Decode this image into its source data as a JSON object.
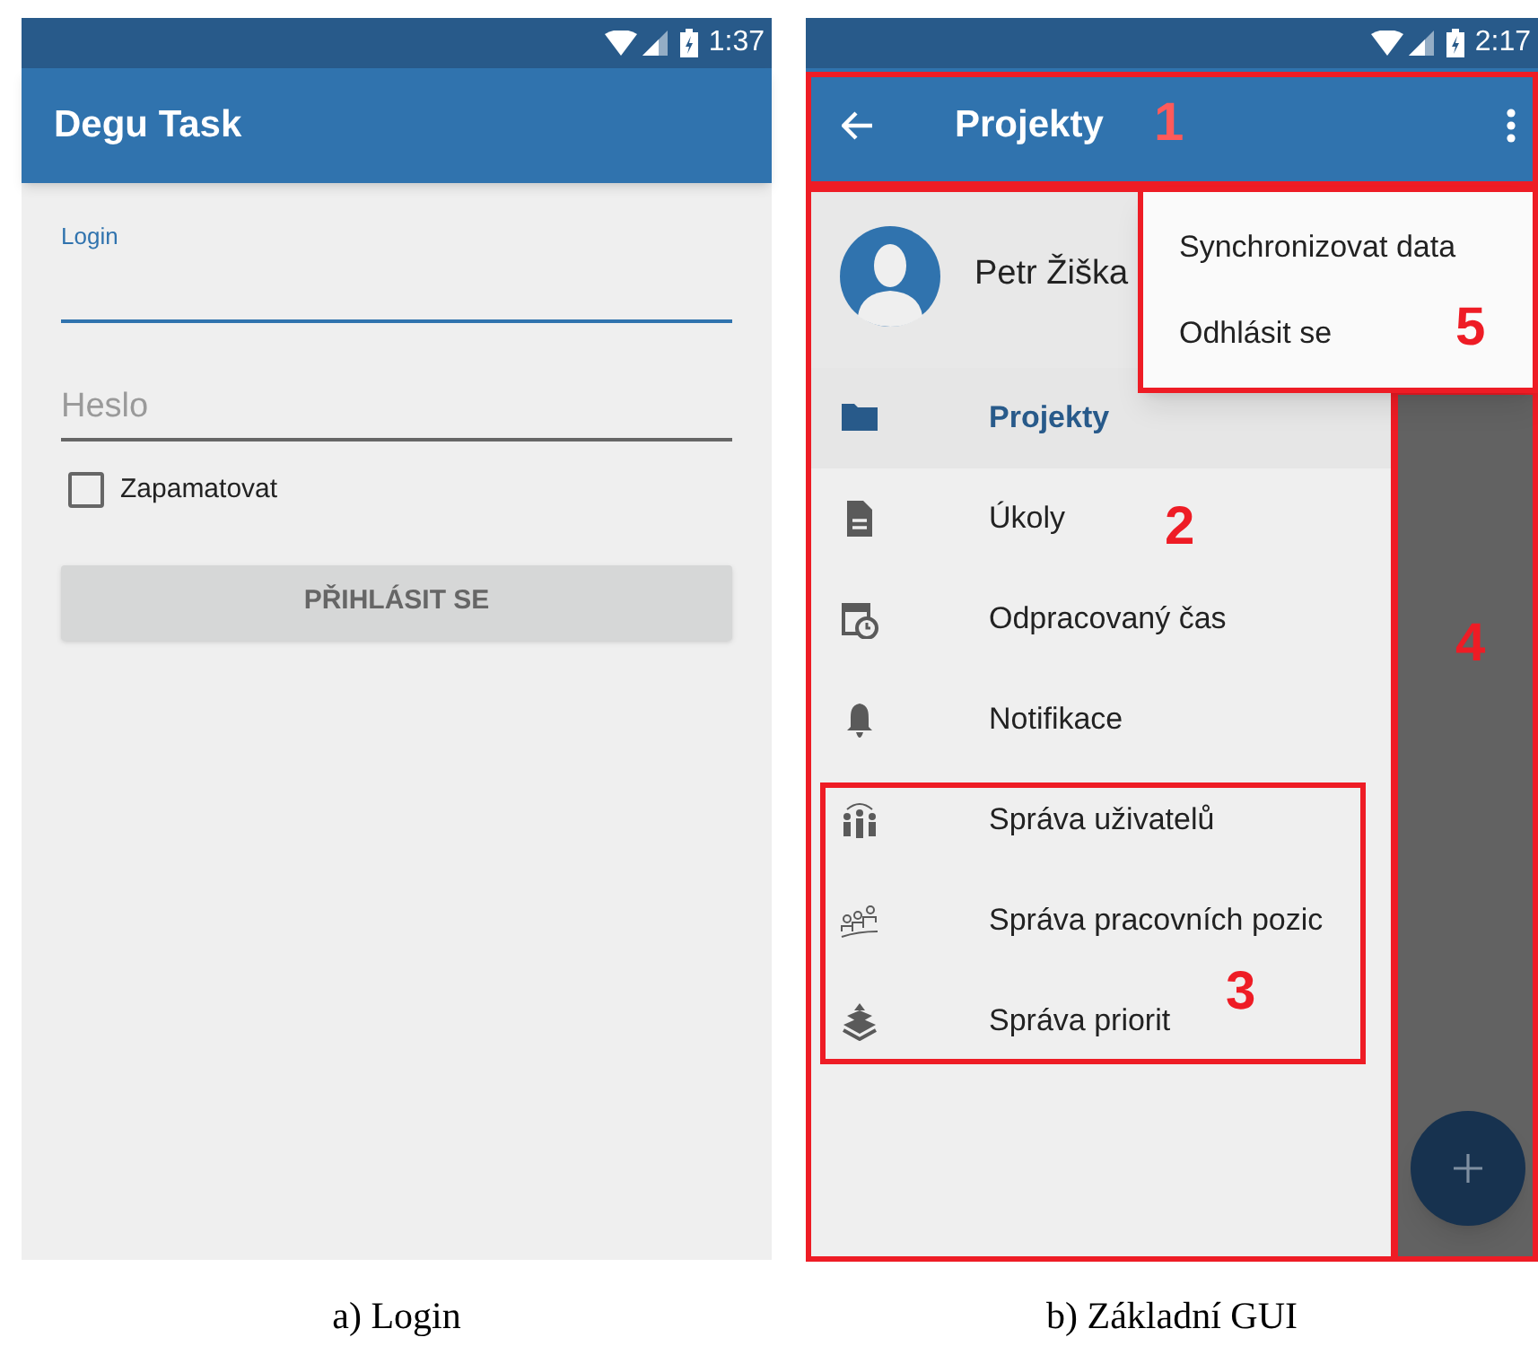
{
  "login_screen": {
    "status_bar": {
      "time": "1:37"
    },
    "app_bar": {
      "title": "Degu Task"
    },
    "login_field": {
      "label": "Login",
      "focused": true
    },
    "password_field": {
      "placeholder": "Heslo"
    },
    "remember": {
      "label": "Zapamatovat",
      "checked": false
    },
    "login_button": {
      "label": "PŘIHLÁSIT SE",
      "disabled": true
    }
  },
  "main_screen": {
    "status_bar": {
      "time": "2:17"
    },
    "app_bar": {
      "title": "Projekty"
    },
    "drawer": {
      "user_name": "Petr Žiška",
      "items": [
        {
          "label": "Projekty",
          "selected": true
        },
        {
          "label": "Úkoly",
          "selected": false
        },
        {
          "label": "Odpracovaný čas",
          "selected": false
        },
        {
          "label": "Notifikace",
          "selected": false
        },
        {
          "label": "Správa uživatelů",
          "selected": false
        },
        {
          "label": "Správa pracovních pozic",
          "selected": false
        },
        {
          "label": "Správa priorit",
          "selected": false
        }
      ]
    },
    "overflow_menu": {
      "items": [
        "Synchronizovat data",
        "Odhlásit se"
      ]
    },
    "annotations": [
      "1",
      "2",
      "3",
      "4",
      "5"
    ]
  },
  "captions": [
    "a) Login",
    "b) Základní GUI"
  ]
}
